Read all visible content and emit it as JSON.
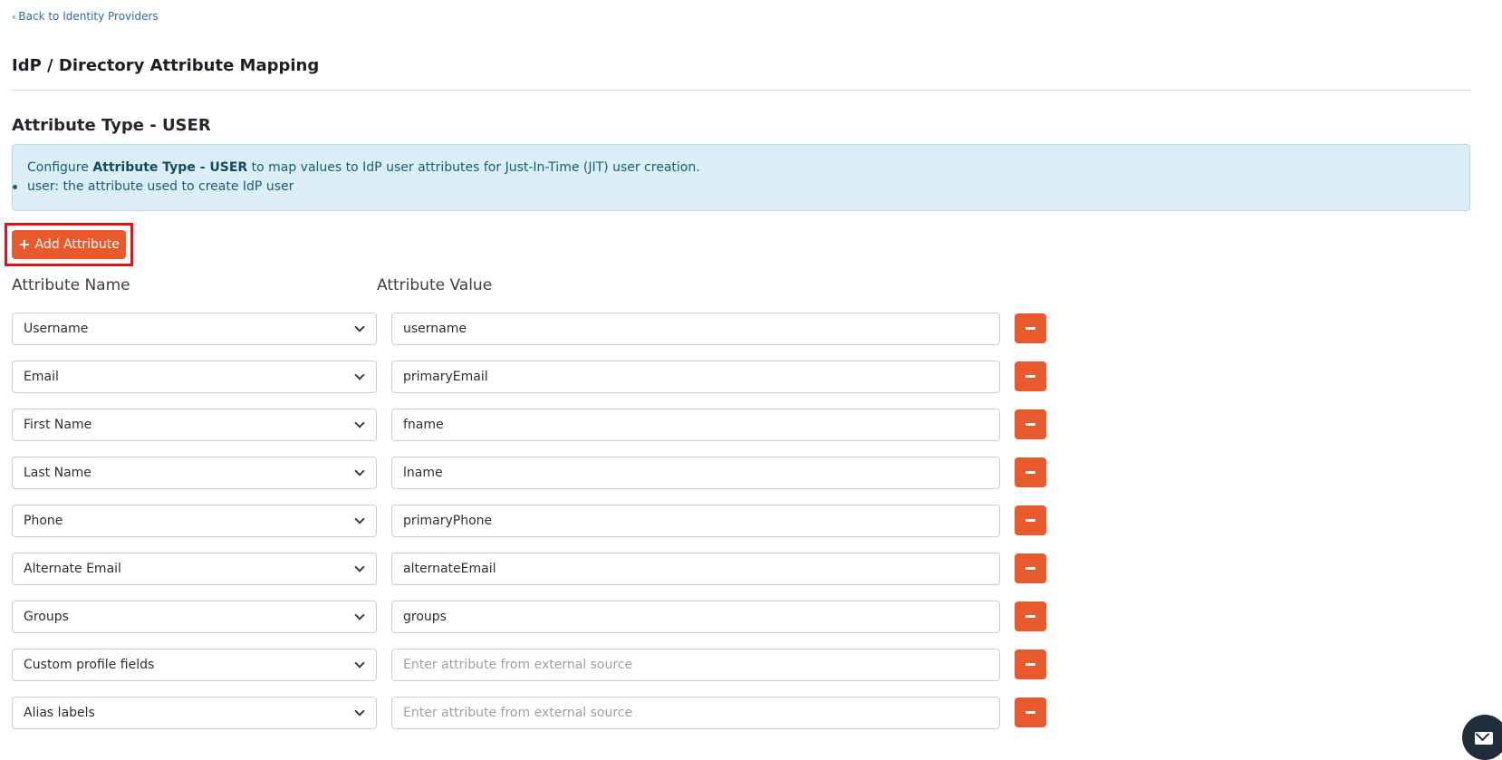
{
  "back_link": {
    "label": "Back to Identity Providers"
  },
  "page_title": "IdP / Directory Attribute Mapping",
  "section_title": "Attribute Type - USER",
  "info": {
    "prefix": "Configure ",
    "bold": "Attribute Type - USER",
    "suffix": " to map values to IdP user attributes for Just-In-Time (JIT) user creation.",
    "bullet": "user: the attribute used to create IdP user"
  },
  "add_button": {
    "label": "Add Attribute"
  },
  "columns": {
    "name": "Attribute Name",
    "value": "Attribute Value"
  },
  "placeholder": "Enter attribute from external source",
  "rows": [
    {
      "name": "Username",
      "value": "username"
    },
    {
      "name": "Email",
      "value": "primaryEmail"
    },
    {
      "name": "First Name",
      "value": "fname"
    },
    {
      "name": "Last Name",
      "value": "lname"
    },
    {
      "name": "Phone",
      "value": "primaryPhone"
    },
    {
      "name": "Alternate Email",
      "value": "alternateEmail"
    },
    {
      "name": "Groups",
      "value": "groups"
    },
    {
      "name": "Custom profile fields",
      "value": ""
    },
    {
      "name": "Alias labels",
      "value": ""
    }
  ],
  "colors": {
    "accent": "#e85a2b",
    "highlight": "#e3101d",
    "info_bg": "#dceef7",
    "link": "#2e6da4"
  },
  "icons": {
    "back": "chevron-left-icon",
    "add": "plus-icon",
    "remove": "minus-icon",
    "select": "chevron-down-icon",
    "chat": "envelope-icon"
  }
}
